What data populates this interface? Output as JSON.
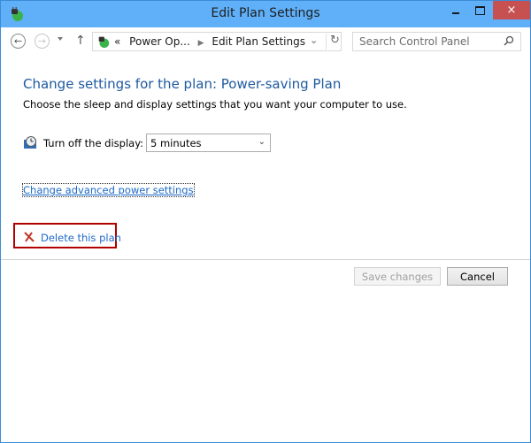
{
  "window": {
    "title": "Edit Plan Settings",
    "app_icon": "power-options-icon",
    "controls": {
      "minimize": "minimize-icon",
      "maximize": "maximize-icon",
      "close": "×"
    }
  },
  "navbar": {
    "back_icon": "←",
    "forward_icon": "→",
    "up_icon": "↑",
    "overflow": "«",
    "breadcrumbs": [
      "Power Op...",
      "Edit Plan Settings"
    ],
    "breadcrumb_sep": "▶",
    "dropdown_icon": "⌄",
    "refresh_icon": "↻",
    "search_placeholder": "Search Control Panel"
  },
  "main": {
    "heading": "Change settings for the plan: Power-saving Plan",
    "subtext": "Choose the sleep and display settings that you want your computer to use.",
    "display_setting": {
      "label": "Turn off the display:",
      "value": "5 minutes",
      "arrow": "⌄"
    },
    "advanced_link": "Change advanced power settings",
    "delete_link": "Delete this plan",
    "highlight_color": "#b00000"
  },
  "footer": {
    "save_label": "Save changes",
    "cancel_label": "Cancel"
  }
}
